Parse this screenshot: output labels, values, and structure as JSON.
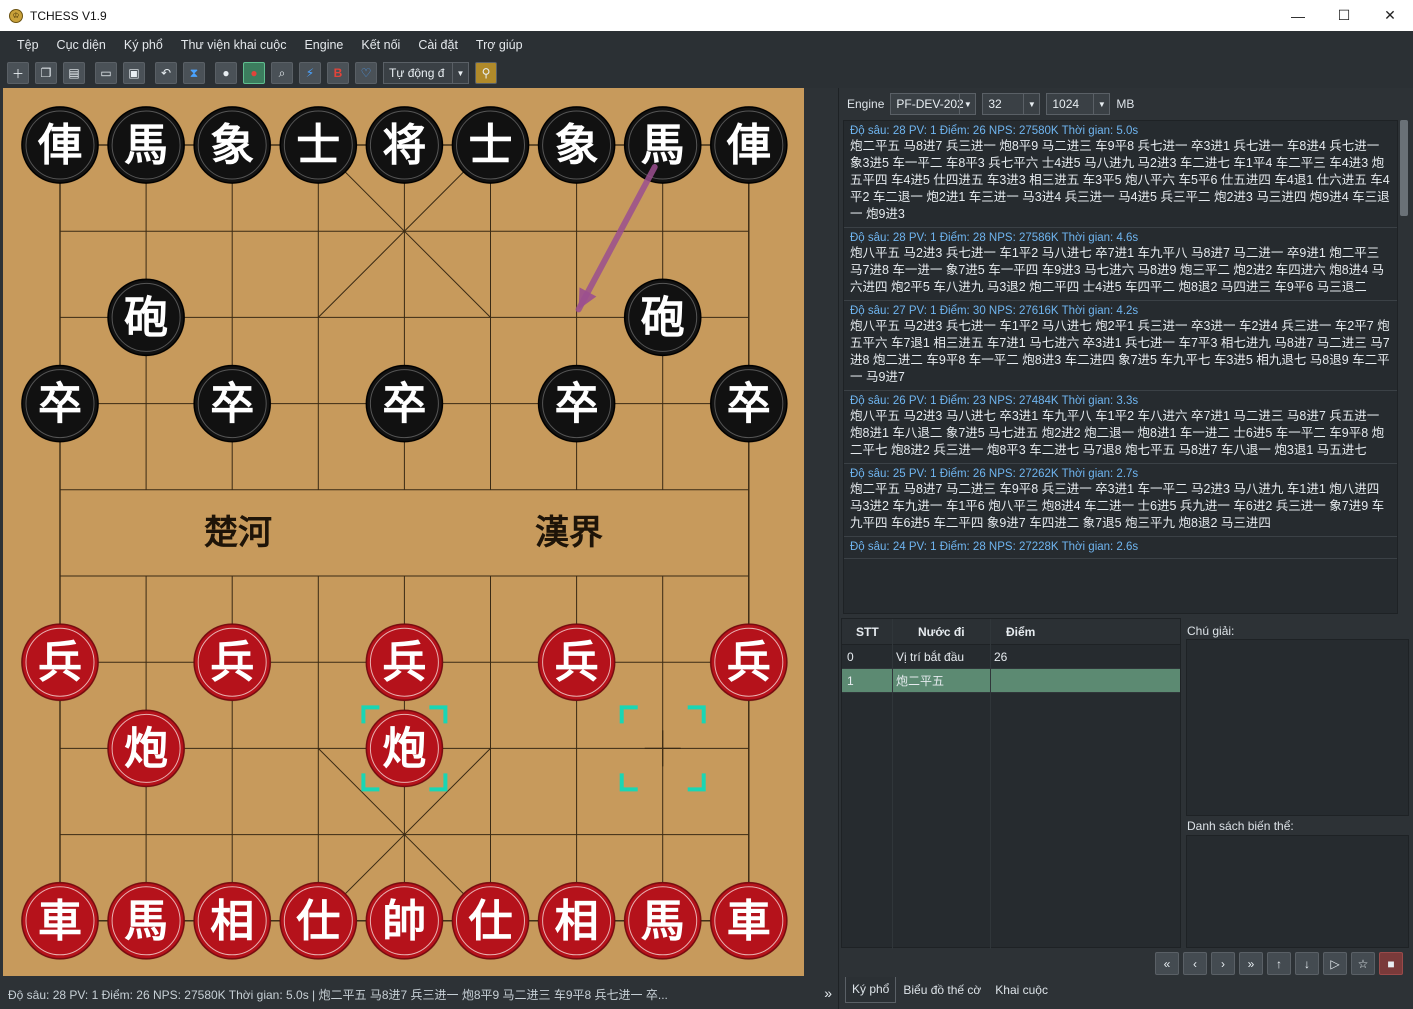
{
  "window": {
    "title": "TCHESS  V1.9",
    "min": "—",
    "max": "☐",
    "close": "✕"
  },
  "menu": [
    "Tệp",
    "Cục diện",
    "Ký phổ",
    "Thư viện khai cuộc",
    "Engine",
    "Kết nối",
    "Cài đặt",
    "Trợ giúp"
  ],
  "toolbar": {
    "mode_value": "Tự động đ",
    "icons": [
      "new-position-icon",
      "copy-icon",
      "paste-icon",
      "open-icon",
      "save-icon",
      "undo-icon",
      "hourglass-icon",
      "player-icon",
      "engine-player-icon",
      "search-icon",
      "lightning-icon",
      "bold-b-icon",
      "heart-icon",
      "link-icon"
    ]
  },
  "board": {
    "river_left": "楚河",
    "river_right": "漢界",
    "black_pieces": [
      {
        "ch": "俥",
        "file": 0,
        "rank": 0
      },
      {
        "ch": "馬",
        "file": 1,
        "rank": 0
      },
      {
        "ch": "象",
        "file": 2,
        "rank": 0
      },
      {
        "ch": "士",
        "file": 3,
        "rank": 0
      },
      {
        "ch": "将",
        "file": 4,
        "rank": 0
      },
      {
        "ch": "士",
        "file": 5,
        "rank": 0
      },
      {
        "ch": "象",
        "file": 6,
        "rank": 0
      },
      {
        "ch": "馬",
        "file": 7,
        "rank": 0
      },
      {
        "ch": "俥",
        "file": 8,
        "rank": 0
      },
      {
        "ch": "砲",
        "file": 1,
        "rank": 2
      },
      {
        "ch": "砲",
        "file": 7,
        "rank": 2
      },
      {
        "ch": "卒",
        "file": 0,
        "rank": 3
      },
      {
        "ch": "卒",
        "file": 2,
        "rank": 3
      },
      {
        "ch": "卒",
        "file": 4,
        "rank": 3
      },
      {
        "ch": "卒",
        "file": 6,
        "rank": 3
      },
      {
        "ch": "卒",
        "file": 8,
        "rank": 3
      }
    ],
    "red_pieces": [
      {
        "ch": "兵",
        "file": 0,
        "rank": 6
      },
      {
        "ch": "兵",
        "file": 2,
        "rank": 6
      },
      {
        "ch": "兵",
        "file": 4,
        "rank": 6
      },
      {
        "ch": "兵",
        "file": 6,
        "rank": 6
      },
      {
        "ch": "兵",
        "file": 8,
        "rank": 6
      },
      {
        "ch": "炮",
        "file": 1,
        "rank": 7
      },
      {
        "ch": "炮",
        "file": 4,
        "rank": 7
      },
      {
        "ch": "車",
        "file": 0,
        "rank": 9
      },
      {
        "ch": "馬",
        "file": 1,
        "rank": 9
      },
      {
        "ch": "相",
        "file": 2,
        "rank": 9
      },
      {
        "ch": "仕",
        "file": 3,
        "rank": 9
      },
      {
        "ch": "帥",
        "file": 4,
        "rank": 9
      },
      {
        "ch": "仕",
        "file": 5,
        "rank": 9
      },
      {
        "ch": "相",
        "file": 6,
        "rank": 9
      },
      {
        "ch": "馬",
        "file": 7,
        "rank": 9
      },
      {
        "ch": "車",
        "file": 8,
        "rank": 9
      }
    ],
    "last_move_from": {
      "file": 7,
      "rank": 7
    },
    "last_move_to": {
      "file": 4,
      "rank": 7
    },
    "hint_arrow": {
      "from": {
        "file": 7,
        "rank": 0
      },
      "to": {
        "file": 6,
        "rank": 2
      }
    },
    "colors": {
      "board": "#c79a5c",
      "line": "#3a2a14",
      "black_piece": "#111111",
      "red_piece": "#b5121b",
      "arrow": "#9b4f8f",
      "highlight": "#19d6b4"
    }
  },
  "status": {
    "text": "Độ sâu: 28  PV: 1  Điểm: 26  NPS: 27580K  Thời gian: 5.0s | 炮二平五  马8进7  兵三进一  炮8平9  马二进三  车9平8  兵七进一  卒...",
    "more": "»"
  },
  "engine_row": {
    "label": "Engine",
    "engine": "PF-DEV-202",
    "threads": "32",
    "hash": "1024",
    "unit": "MB"
  },
  "analysis": [
    {
      "header": "Độ sâu: 28  PV: 1  Điểm: 26  NPS: 27580K  Thời gian: 5.0s",
      "pv": "炮二平五 马8进7 兵三进一 炮8平9 马二进三 车9平8 兵七进一 卒3进1 兵七进一 车8进4 兵七进一 象3进5 车一平二 车8平3 兵七平六 士4进5 马八进九 马2进3 车二进七 车1平4 车二平三 车4进3 炮五平四 车4进5 仕四进五 车3进3 相三进五 车3平5 炮八平六 车5平6 仕五进四 车4退1 仕六进五 车4平2 车二退一 炮2进1 车三进一 马3进4 兵三进一 马4进5 兵三平二 炮2进3 马三进四 炮9进4 车三退一 炮9进3"
    },
    {
      "header": "Độ sâu: 28  PV: 1  Điểm: 28  NPS: 27586K  Thời gian: 4.6s",
      "pv": "炮八平五 马2进3 兵七进一 车1平2 马八进七 卒7进1 车九平八 马8进7 马二进一 卒9进1 炮二平三 马7进8 车一进一 象7进5 车一平四 车9进3 马七进六 马8进9 炮三平二 炮2进2 车四进六 炮8进4 马六进四 炮2平5 车八进九 马3退2 炮二平四 士4进5 车四平二 炮8退2 马四进三 车9平6 马三退二"
    },
    {
      "header": "Độ sâu: 27  PV: 1  Điểm: 30  NPS: 27616K  Thời gian: 4.2s",
      "pv": "炮八平五 马2进3 兵七进一 车1平2 马八进七 炮2平1 兵三进一 卒3进一 车2进4 兵三进一 车2平7 炮五平六 车7退1 相三进五 车7进1 马七进六 卒3进1 兵七进一 车7平3 相七进九 马8进7 马二进三 马7进8 炮二进二 车9平8 车一平二 炮8进3 车二进四 象7进5 车九平七 车3进5 相九退七 马8退9 车二平一 马9进7"
    },
    {
      "header": "Độ sâu: 26  PV: 1  Điểm: 23  NPS: 27484K  Thời gian: 3.3s",
      "pv": "炮八平五 马2进3 马八进七 卒3进1 车九平八 车1平2 车八进六 卒7进1 马二进三 马8进7 兵五进一 炮8进1 车八退二 象7进5 马七进五 炮2进2 炮二退一 炮8进1 车一进二 士6进5 车一平二 车9平8 炮二平七 炮8进2 兵三进一 炮8平3 车二进七 马7退8 炮七平五 马8进7 车八退一 炮3退1 马五进七"
    },
    {
      "header": "Độ sâu: 25  PV: 1  Điểm: 26  NPS: 27262K  Thời gian: 2.7s",
      "pv": "炮二平五 马8进7 马二进三 车9平8 兵三进一 卒3进1 车一平二 马2进3 马八进九 车1进1 炮八进四 马3进2 车九进一 车1平6 炮八平三 炮8进4 车二进一 士6进5 兵九进一 车6进2 兵三进一 象7进9 车九平四 车6进5 车二平四 象9进7 车四进二 象7退5 炮三平九 炮8退2 马三进四"
    },
    {
      "header": "Độ sâu: 24  PV: 1  Điểm: 28  NPS: 27228K  Thời gian: 2.6s",
      "pv": ""
    }
  ],
  "movelist": {
    "headers": {
      "stt": "STT",
      "move": "Nước đi",
      "score": "Điểm"
    },
    "rows": [
      {
        "stt": "0",
        "move": "Vị trí bắt đầu",
        "score": "26"
      },
      {
        "stt": "1",
        "move": "炮二平五",
        "score": ""
      }
    ]
  },
  "notes_label": "Chú giải:",
  "variations_label": "Danh sách biến thể:",
  "nav": [
    "«",
    "‹",
    "›",
    "»",
    "↑",
    "↓",
    "▷",
    "☆",
    "■"
  ],
  "tabs": [
    "Ký phổ",
    "Biểu đồ thế cờ",
    "Khai cuộc"
  ]
}
